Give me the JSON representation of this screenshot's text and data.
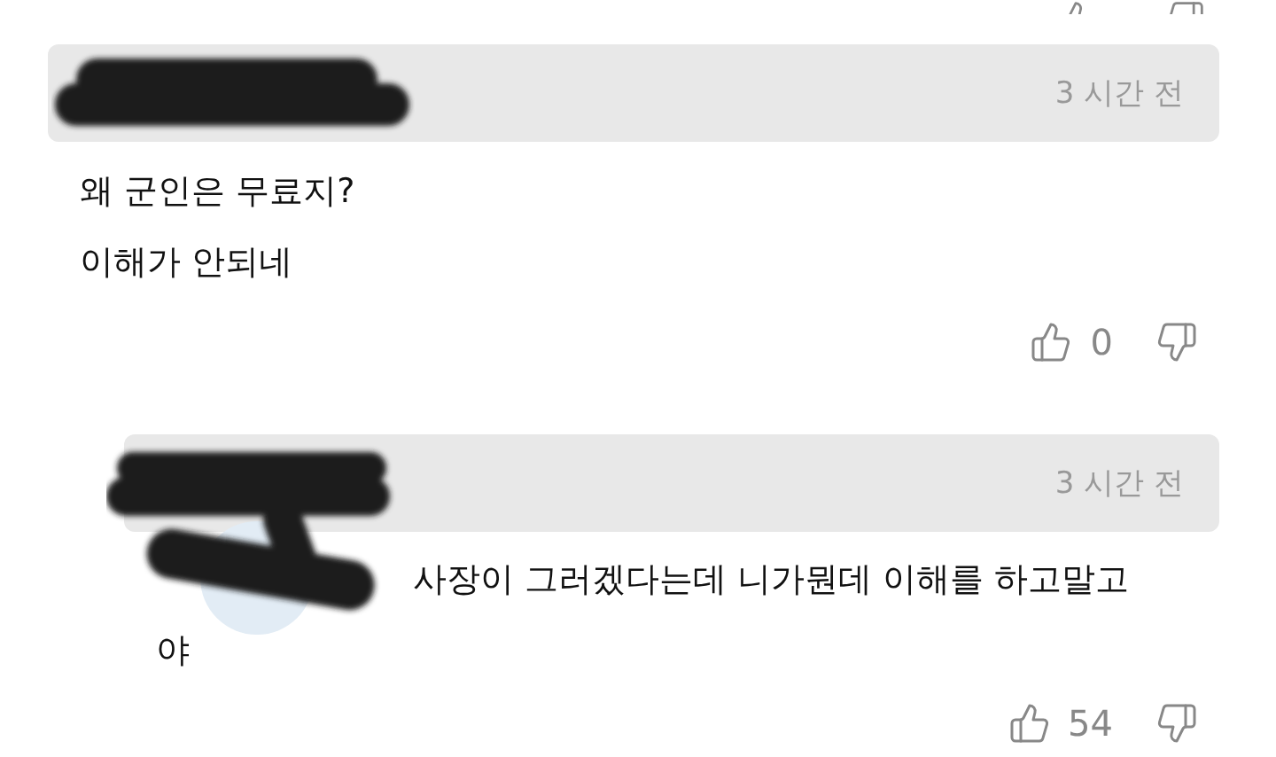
{
  "comments": [
    {
      "kind": "comment",
      "time": "3 시간 전",
      "lines": [
        "왜 군인은 무료지?",
        "이해가 안되네"
      ],
      "likes": "0"
    },
    {
      "kind": "reply",
      "time": "3 시간 전",
      "lines": [
        "사장이 그러겠다는데 니가뭔데 이해를 하고말고",
        "야"
      ],
      "likes": "54"
    }
  ]
}
